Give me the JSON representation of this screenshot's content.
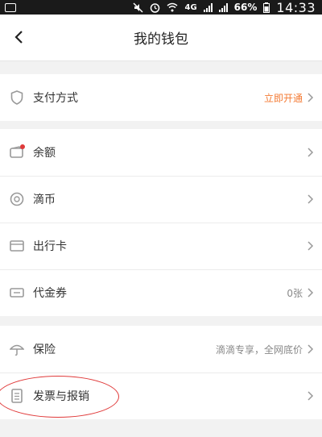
{
  "status_bar": {
    "network": "4G",
    "battery": "66%",
    "time": "14:33"
  },
  "header": {
    "title": "我的钱包"
  },
  "payment_section": {
    "items": [
      {
        "label": "支付方式",
        "value": "立即开通",
        "icon": "shield-icon"
      }
    ]
  },
  "assets_section": {
    "items": [
      {
        "label": "余额",
        "value": "",
        "icon": "wallet-icon"
      },
      {
        "label": "滴币",
        "value": "",
        "icon": "coin-icon"
      },
      {
        "label": "出行卡",
        "value": "",
        "icon": "card-icon"
      },
      {
        "label": "代金券",
        "value": "0张",
        "icon": "ticket-icon"
      }
    ]
  },
  "other_section": {
    "items": [
      {
        "label": "保险",
        "value": "滴滴专享，全网底价",
        "icon": "umbrella-icon"
      },
      {
        "label": "发票与报销",
        "value": "",
        "icon": "receipt-icon"
      }
    ]
  },
  "colors": {
    "accent": "#f47a33",
    "badge": "#e03a3a",
    "annotation": "#e03a3a"
  }
}
